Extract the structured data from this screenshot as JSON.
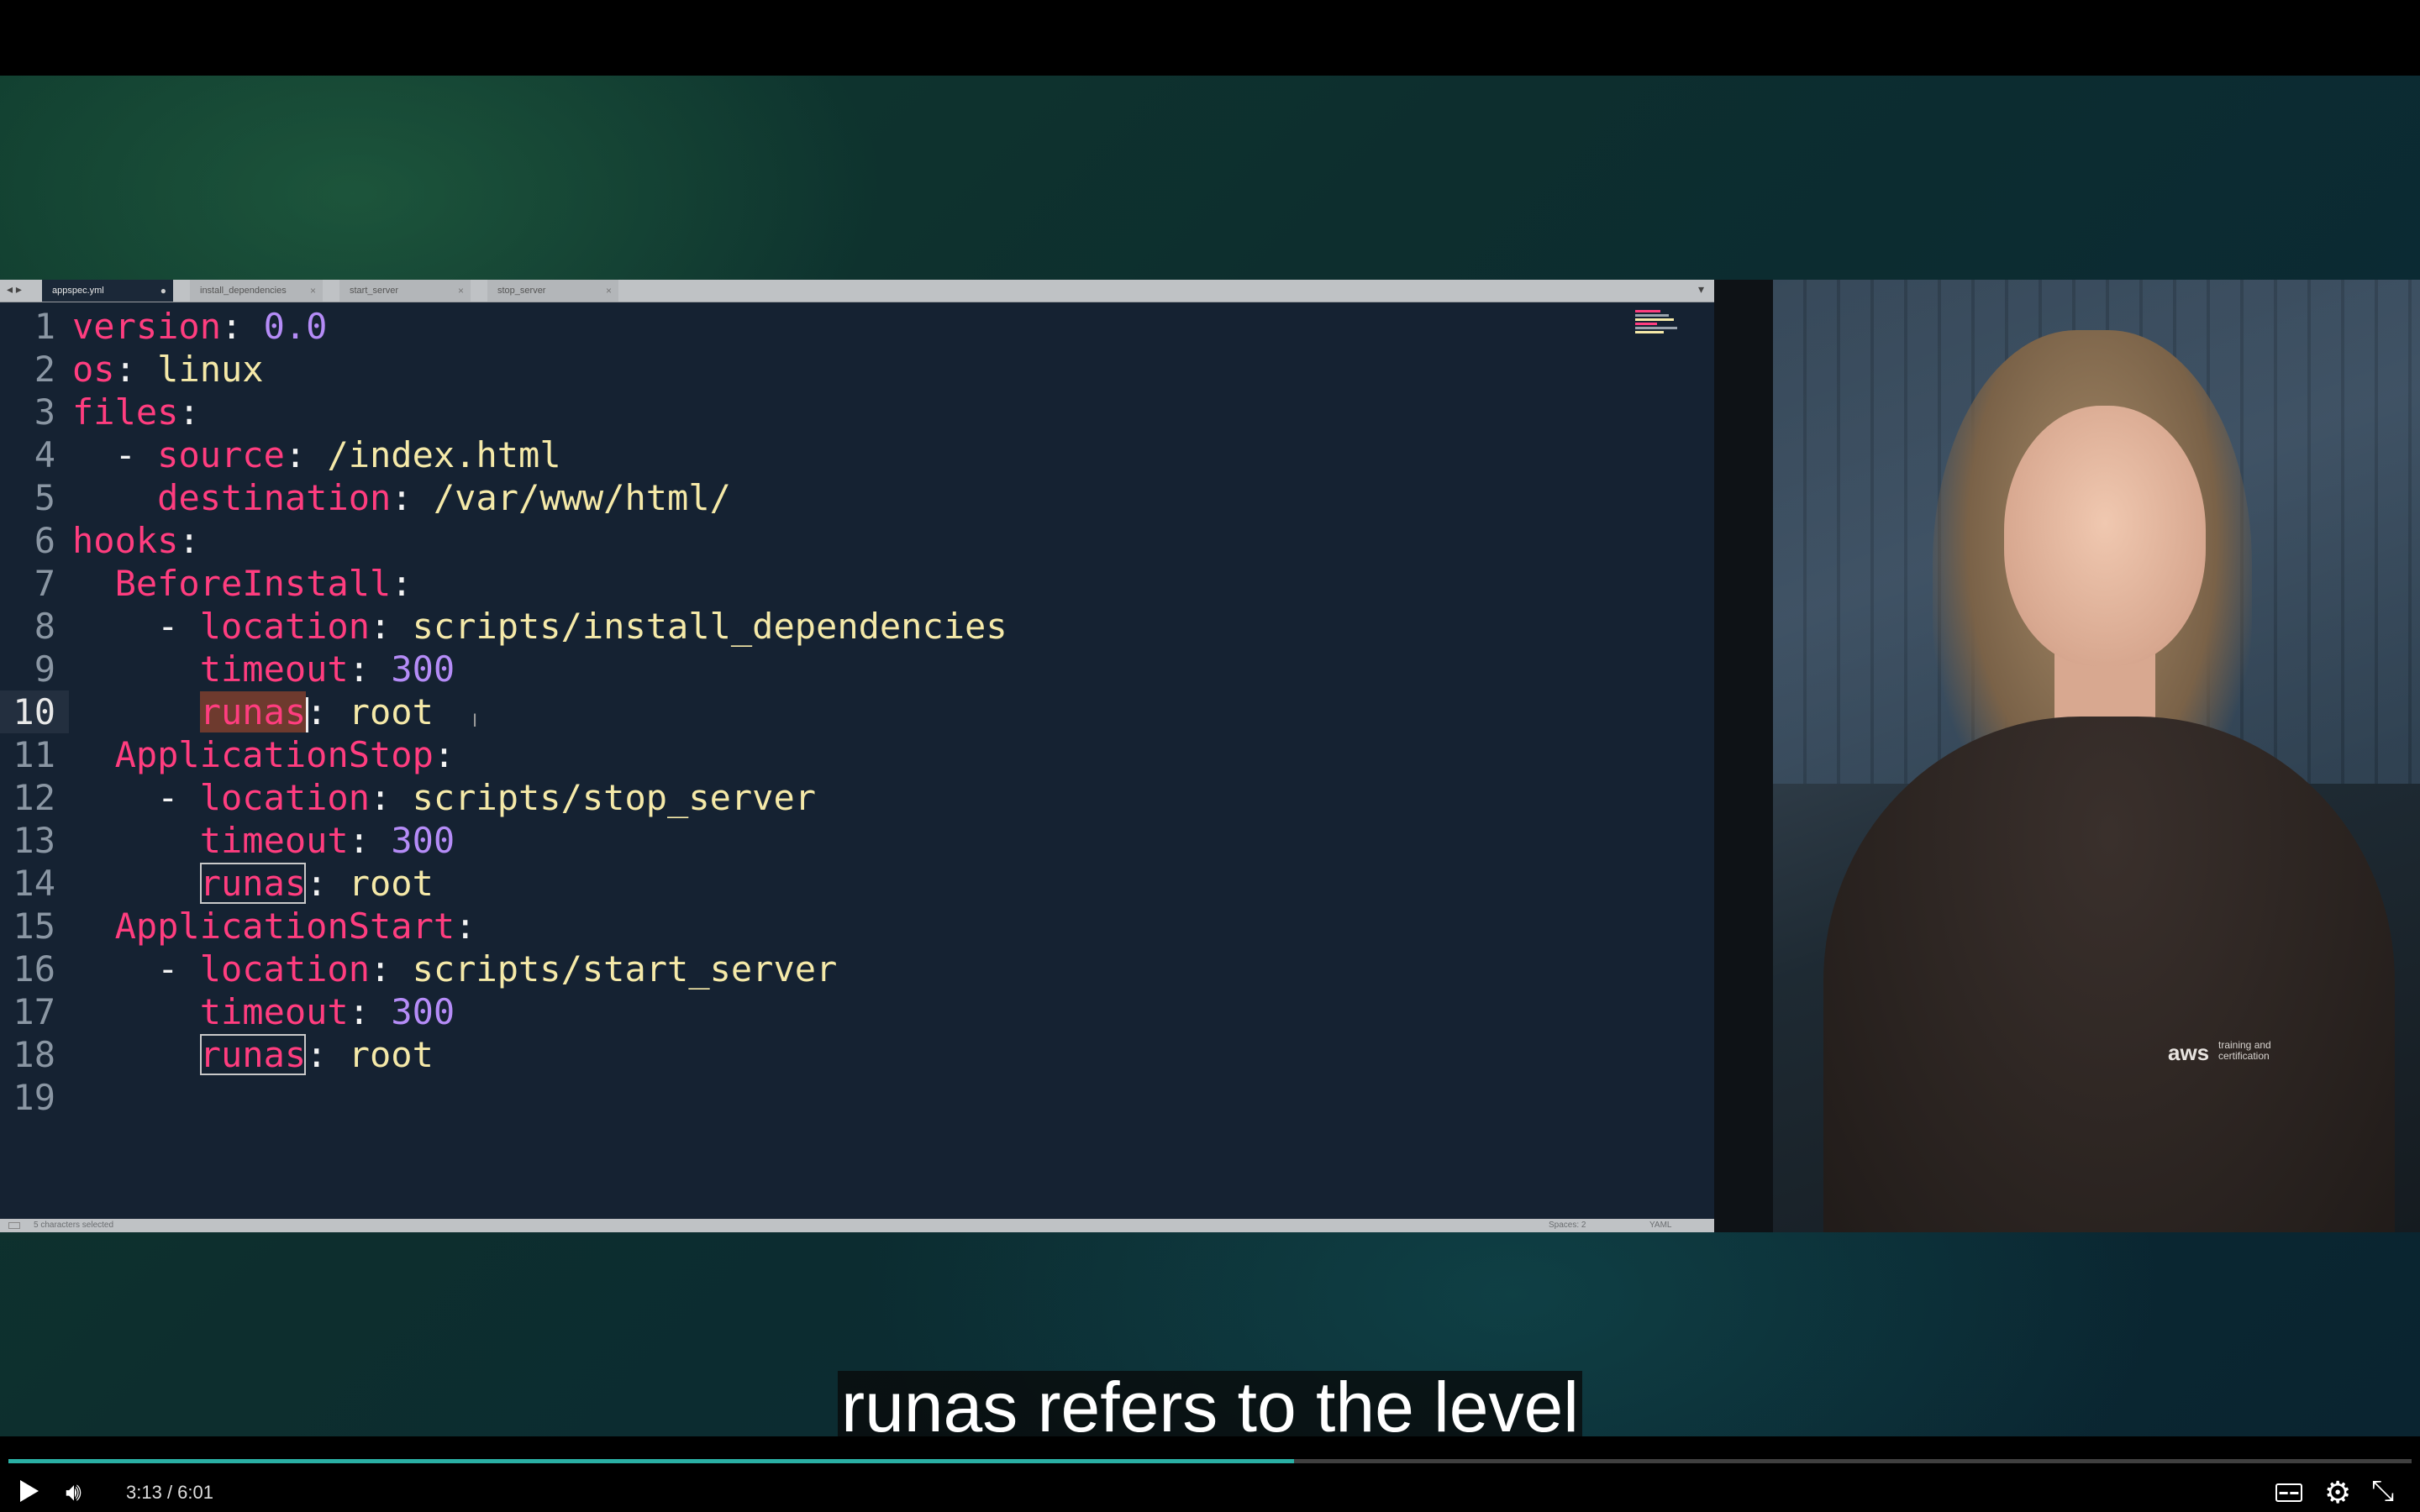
{
  "editor": {
    "tabs": [
      {
        "label": "appspec.yml",
        "close": "●",
        "active": true
      },
      {
        "label": "install_dependencies",
        "close": "×",
        "active": false
      },
      {
        "label": "start_server",
        "close": "×",
        "active": false
      },
      {
        "label": "stop_server",
        "close": "×",
        "active": false
      }
    ],
    "nav_arrows": "◂ ▸",
    "tab_menu": "▾",
    "lines": [
      {
        "n": "1",
        "tokens": [
          {
            "t": "version",
            "c": "k"
          },
          {
            "t": ": ",
            "c": "p"
          },
          {
            "t": "0.0",
            "c": "n"
          }
        ]
      },
      {
        "n": "2",
        "tokens": [
          {
            "t": "os",
            "c": "k"
          },
          {
            "t": ": ",
            "c": "p"
          },
          {
            "t": "linux",
            "c": "v"
          }
        ]
      },
      {
        "n": "3",
        "tokens": [
          {
            "t": "files",
            "c": "k"
          },
          {
            "t": ":",
            "c": "p"
          }
        ]
      },
      {
        "n": "4",
        "tokens": [
          {
            "t": "  - ",
            "c": "p"
          },
          {
            "t": "source",
            "c": "k"
          },
          {
            "t": ": ",
            "c": "p"
          },
          {
            "t": "/index.html",
            "c": "v"
          }
        ]
      },
      {
        "n": "5",
        "tokens": [
          {
            "t": "    ",
            "c": "p"
          },
          {
            "t": "destination",
            "c": "k"
          },
          {
            "t": ": ",
            "c": "p"
          },
          {
            "t": "/var/www/html/",
            "c": "v"
          }
        ]
      },
      {
        "n": "6",
        "tokens": [
          {
            "t": "hooks",
            "c": "k"
          },
          {
            "t": ":",
            "c": "p"
          }
        ]
      },
      {
        "n": "7",
        "tokens": [
          {
            "t": "  ",
            "c": "p"
          },
          {
            "t": "BeforeInstall",
            "c": "k"
          },
          {
            "t": ":",
            "c": "p"
          }
        ]
      },
      {
        "n": "8",
        "tokens": [
          {
            "t": "    - ",
            "c": "p"
          },
          {
            "t": "location",
            "c": "k"
          },
          {
            "t": ": ",
            "c": "p"
          },
          {
            "t": "scripts/install_dependencies",
            "c": "v"
          }
        ]
      },
      {
        "n": "9",
        "tokens": [
          {
            "t": "      ",
            "c": "p"
          },
          {
            "t": "timeout",
            "c": "k"
          },
          {
            "t": ": ",
            "c": "p"
          },
          {
            "t": "300",
            "c": "n"
          }
        ]
      },
      {
        "n": "10",
        "current": true,
        "tokens": [
          {
            "t": "      ",
            "c": "p"
          },
          {
            "t": "runas",
            "c": "k hl-sel",
            "caret": true
          },
          {
            "t": ": ",
            "c": "p"
          },
          {
            "t": "root",
            "c": "v"
          }
        ]
      },
      {
        "n": "11",
        "tokens": [
          {
            "t": "  ",
            "c": "p"
          },
          {
            "t": "ApplicationStop",
            "c": "k"
          },
          {
            "t": ":",
            "c": "p"
          }
        ]
      },
      {
        "n": "12",
        "tokens": [
          {
            "t": "    - ",
            "c": "p"
          },
          {
            "t": "location",
            "c": "k"
          },
          {
            "t": ": ",
            "c": "p"
          },
          {
            "t": "scripts/stop_server",
            "c": "v"
          }
        ]
      },
      {
        "n": "13",
        "tokens": [
          {
            "t": "      ",
            "c": "p"
          },
          {
            "t": "timeout",
            "c": "k"
          },
          {
            "t": ": ",
            "c": "p"
          },
          {
            "t": "300",
            "c": "n"
          }
        ]
      },
      {
        "n": "14",
        "tokens": [
          {
            "t": "      ",
            "c": "p"
          },
          {
            "t": "runas",
            "c": "k hl-box"
          },
          {
            "t": ": ",
            "c": "p"
          },
          {
            "t": "root",
            "c": "v"
          }
        ]
      },
      {
        "n": "15",
        "tokens": [
          {
            "t": "  ",
            "c": "p"
          },
          {
            "t": "ApplicationStart",
            "c": "k"
          },
          {
            "t": ":",
            "c": "p"
          }
        ]
      },
      {
        "n": "16",
        "tokens": [
          {
            "t": "    - ",
            "c": "p"
          },
          {
            "t": "location",
            "c": "k"
          },
          {
            "t": ": ",
            "c": "p"
          },
          {
            "t": "scripts/start_server",
            "c": "v"
          }
        ]
      },
      {
        "n": "17",
        "tokens": [
          {
            "t": "      ",
            "c": "p"
          },
          {
            "t": "timeout",
            "c": "k"
          },
          {
            "t": ": ",
            "c": "p"
          },
          {
            "t": "300",
            "c": "n"
          }
        ]
      },
      {
        "n": "18",
        "tokens": [
          {
            "t": "      ",
            "c": "p"
          },
          {
            "t": "runas",
            "c": "k hl-box"
          },
          {
            "t": ": ",
            "c": "p"
          },
          {
            "t": "root",
            "c": "v"
          }
        ]
      },
      {
        "n": "19",
        "tokens": []
      }
    ],
    "status": {
      "selection": "5 characters selected",
      "spaces": "Spaces: 2",
      "syntax": "YAML"
    }
  },
  "presenter": {
    "shirt_logo": "aws",
    "shirt_logo_sub": "training and certification"
  },
  "subtitle": "runas refers to the level",
  "player": {
    "current_time": "3:13",
    "separator": " / ",
    "duration": "6:01",
    "progress_fraction": 0.535,
    "accent_color": "#2ab0a5",
    "icons": [
      "play-icon",
      "volume-icon",
      "closed-captions-icon",
      "gear-icon",
      "exit-fullscreen-icon"
    ]
  }
}
